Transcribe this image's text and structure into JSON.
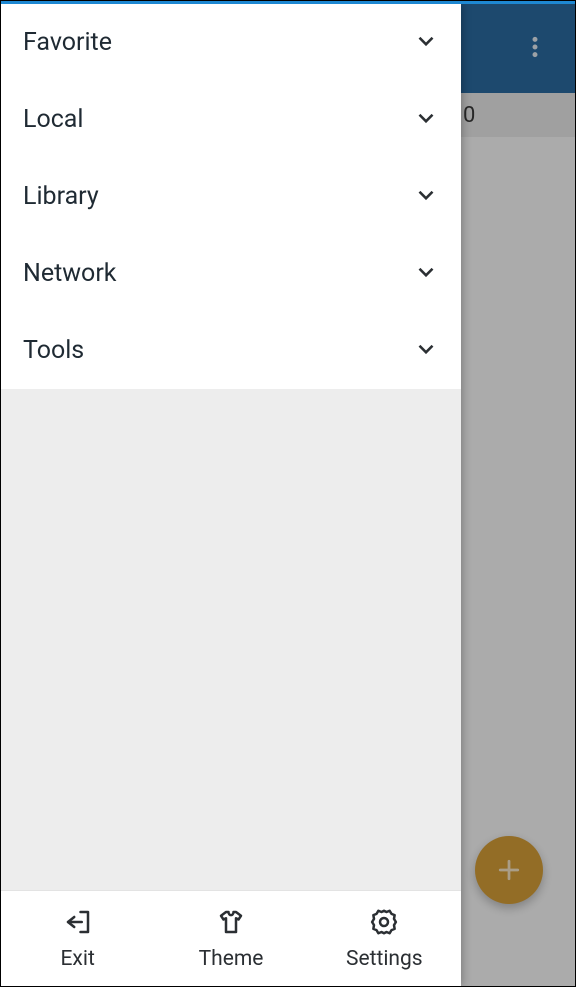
{
  "drawer": {
    "items": [
      {
        "label": "Favorite"
      },
      {
        "label": "Local"
      },
      {
        "label": "Library"
      },
      {
        "label": "Network"
      },
      {
        "label": "Tools"
      }
    ],
    "bottom": {
      "exit": {
        "label": "Exit"
      },
      "theme": {
        "label": "Theme"
      },
      "settings": {
        "label": "Settings"
      }
    }
  },
  "subbar": {
    "value": "0"
  },
  "colors": {
    "accent": "#1e88d2",
    "appbar": "#2b6ca3",
    "fab": "#d9a139"
  }
}
